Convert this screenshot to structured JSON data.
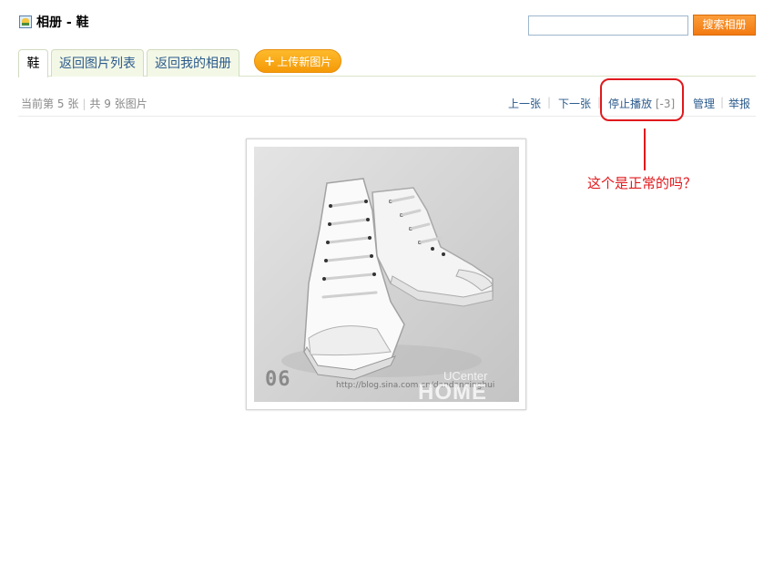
{
  "header": {
    "title": "相册 - 鞋",
    "search_placeholder": "",
    "search_button": "搜索相册"
  },
  "tabs": [
    {
      "label": "鞋",
      "active": true
    },
    {
      "label": "返回图片列表",
      "active": false
    },
    {
      "label": "返回我的相册",
      "active": false
    }
  ],
  "upload": {
    "plus": "+",
    "label": "上传新图片"
  },
  "info": {
    "current_prefix": "当前第",
    "current_index": "5",
    "current_unit": "张",
    "total_prefix": "共",
    "total_count": "9",
    "total_unit": "张图片"
  },
  "nav": {
    "prev": "上一张",
    "next": "下一张",
    "stop": "停止播放",
    "countdown": "[-3]",
    "manage": "管理",
    "report": "举报"
  },
  "photo": {
    "number": "06",
    "url": "http://blog.sina.com.cn/dandanqinghui",
    "watermark_top": "UCenter",
    "watermark_bottom": "HOME",
    "subject": "white-high-top-sneakers"
  },
  "annotation": {
    "text": "这个是正常的吗？",
    "color": "#e0191d"
  },
  "colors": {
    "accent_orange": "#f37a10",
    "link_blue": "#2b5a8c",
    "tab_bg": "#f3f8e6"
  }
}
